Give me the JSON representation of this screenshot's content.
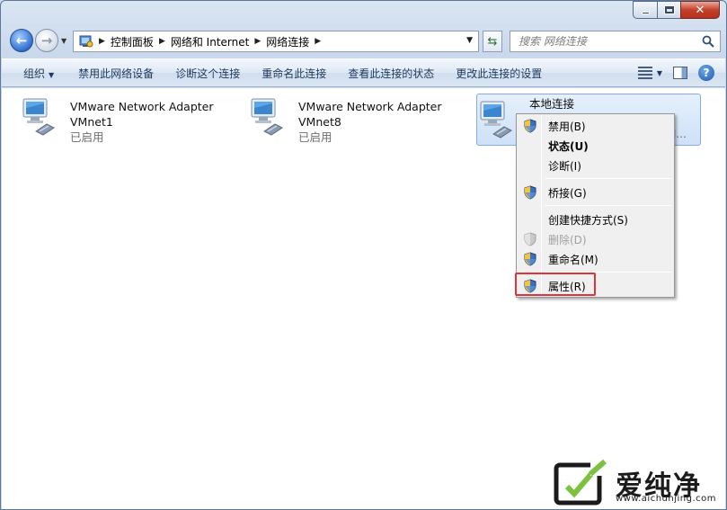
{
  "window": {
    "caption_buttons": {
      "minimize": "minimize",
      "maximize": "maximize",
      "close": "✕"
    }
  },
  "nav": {
    "breadcrumb": [
      "控制面板",
      "网络和 Internet",
      "网络连接"
    ],
    "search_placeholder": "搜索 网络连接"
  },
  "toolbar": {
    "organize": "组织",
    "commands": [
      "禁用此网络设备",
      "诊断这个连接",
      "重命名此连接",
      "查看此连接的状态",
      "更改此连接的设置"
    ]
  },
  "adapters": [
    {
      "name": "VMware Network Adapter",
      "sub": "VMnet1",
      "status": "已启用"
    },
    {
      "name": "VMware Network Adapter",
      "sub": "VMnet8",
      "status": "已启用"
    },
    {
      "name": "本地连接",
      "sub": "",
      "status": "",
      "partial": "rol..."
    }
  ],
  "context_menu": {
    "items": [
      {
        "label": "禁用(B)",
        "shield": true
      },
      {
        "label": "状态(U)",
        "bold": true
      },
      {
        "label": "诊断(I)"
      },
      {
        "label": "桥接(G)",
        "shield": true
      },
      {
        "label": "创建快捷方式(S)"
      },
      {
        "label": "删除(D)",
        "shield": true,
        "disabled": true
      },
      {
        "label": "重命名(M)",
        "shield": true
      },
      {
        "label": "属性(R)",
        "shield": true
      }
    ]
  },
  "watermark": {
    "text": "爱纯净",
    "url": "www.aichunjing.com"
  },
  "colors": {
    "highlight_red": "#e0333a",
    "selection": "#cde1f7"
  }
}
